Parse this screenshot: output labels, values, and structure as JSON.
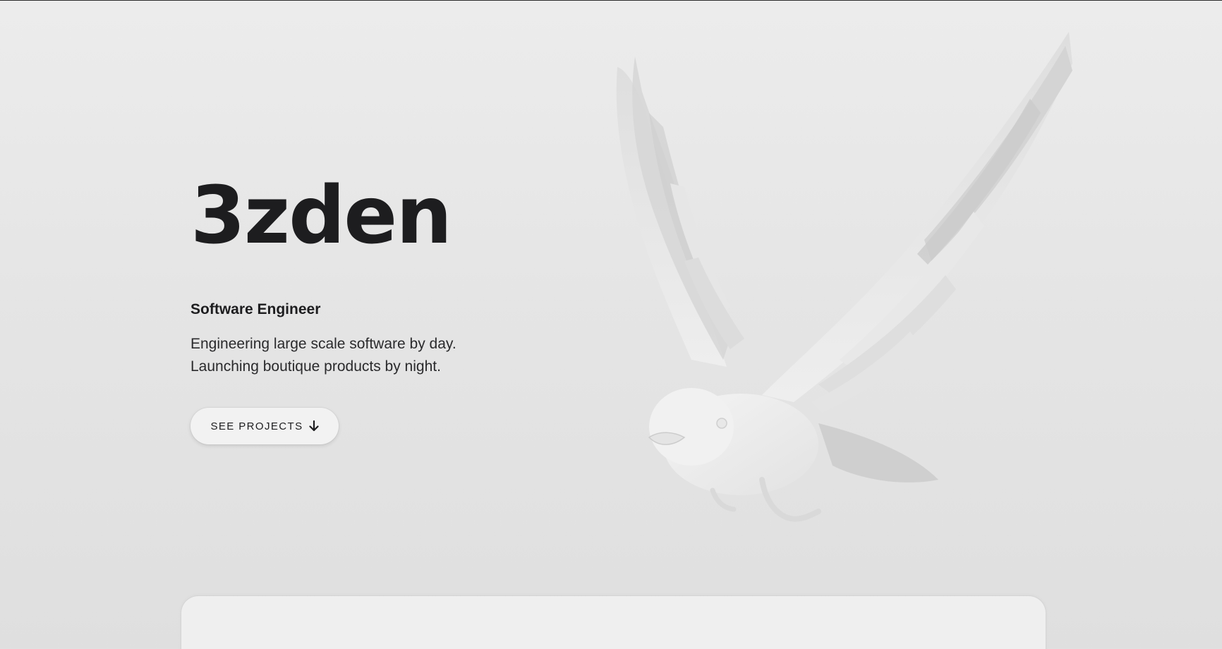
{
  "hero": {
    "title": "3zden",
    "role": "Software Engineer",
    "tagline_line1": "Engineering large scale software by day.",
    "tagline_line2": "Launching boutique products by night.",
    "cta_label": "SEE PROJECTS",
    "cta_icon": "arrow-down-icon"
  },
  "illustration": {
    "subject": "bird-3d-render"
  },
  "colors": {
    "background": "#e6e6e6",
    "text": "#1d1d1f",
    "button": "#f2f2f2",
    "panel": "#efefef"
  }
}
